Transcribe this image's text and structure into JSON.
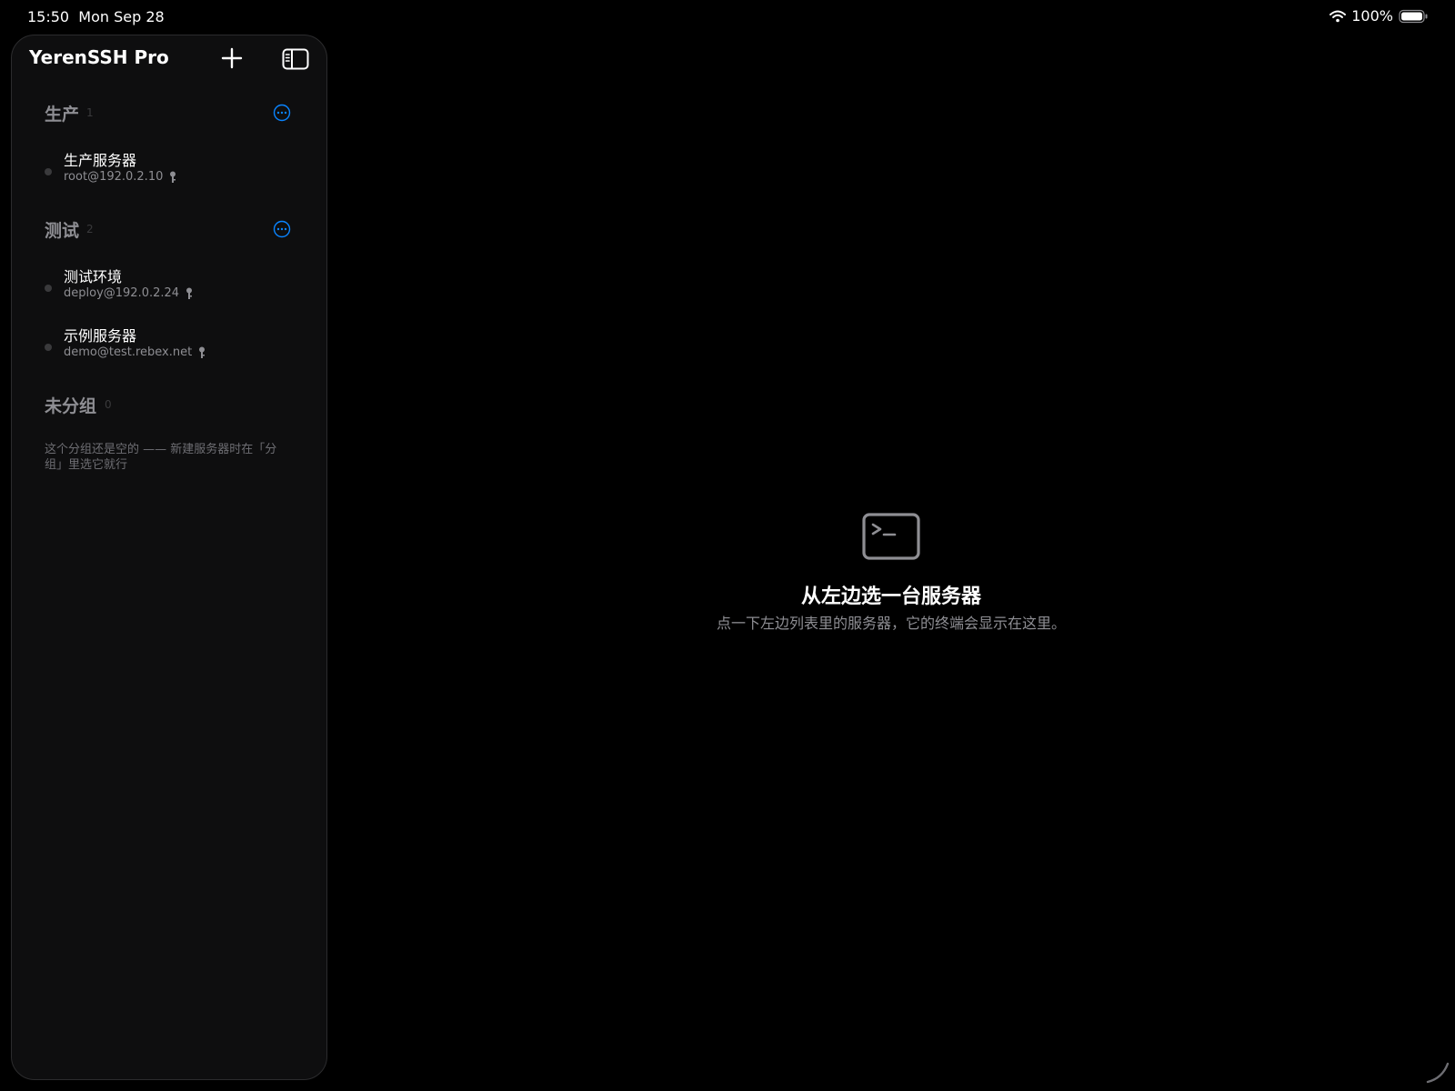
{
  "status_bar": {
    "time": "15:50",
    "date": "Mon Sep 28",
    "battery": "100%",
    "icons": [
      "wifi-icon",
      "battery-icon"
    ]
  },
  "sidebar": {
    "title": "YerenSSH Pro",
    "icons": [
      "plus-icon",
      "sidebar-toggle-icon"
    ],
    "groups": [
      {
        "name": "生产",
        "count": "1",
        "servers": [
          {
            "name": "生产服务器",
            "address": "root@192.0.2.10"
          }
        ]
      },
      {
        "name": "测试",
        "count": "2",
        "servers": [
          {
            "name": "测试环境",
            "address": "deploy@192.0.2.24"
          },
          {
            "name": "示例服务器",
            "address": "demo@test.rebex.net"
          }
        ]
      },
      {
        "name": "未分组",
        "count": "0",
        "empty_note": "这个分组还是空的 —— 新建服务器时在「分组」里选它就行"
      }
    ]
  },
  "detail": {
    "icon": "terminal-icon",
    "title": "从左边选一台服务器",
    "subtitle": "点一下左边列表里的服务器，它的终端会显示在这里。"
  },
  "colors": {
    "accent": "#0a84ff",
    "background": "#000000",
    "sidebar_bg": "#0e0e0f",
    "secondary_text": "#8e8e93"
  }
}
